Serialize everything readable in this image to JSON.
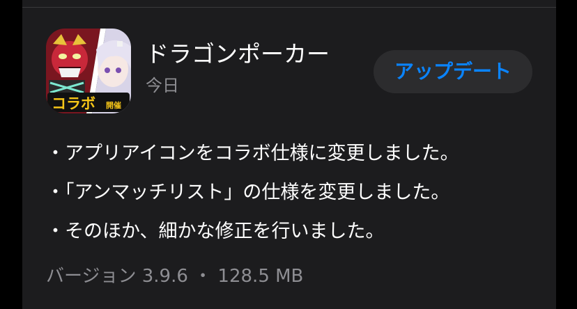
{
  "app": {
    "name": "ドラゴンポーカー",
    "date": "今日",
    "update_label": "アップデート",
    "icon_badge": "コラボ",
    "icon_badge_sub": "開催"
  },
  "release_notes": [
    "・アプリアイコンをコラボ仕様に変更しました。",
    "・「アンマッチリスト」の仕様を変更しました。",
    "・そのほか、細かな修正を行いました。"
  ],
  "version_info": "バージョン 3.9.6 ・ 128.5 MB",
  "colors": {
    "background": "#000000",
    "card": "#1c1c1e",
    "button_bg": "#2c2c2e",
    "accent": "#0a84ff",
    "primary_text": "#ffffff",
    "secondary_text": "#8e8e93"
  }
}
